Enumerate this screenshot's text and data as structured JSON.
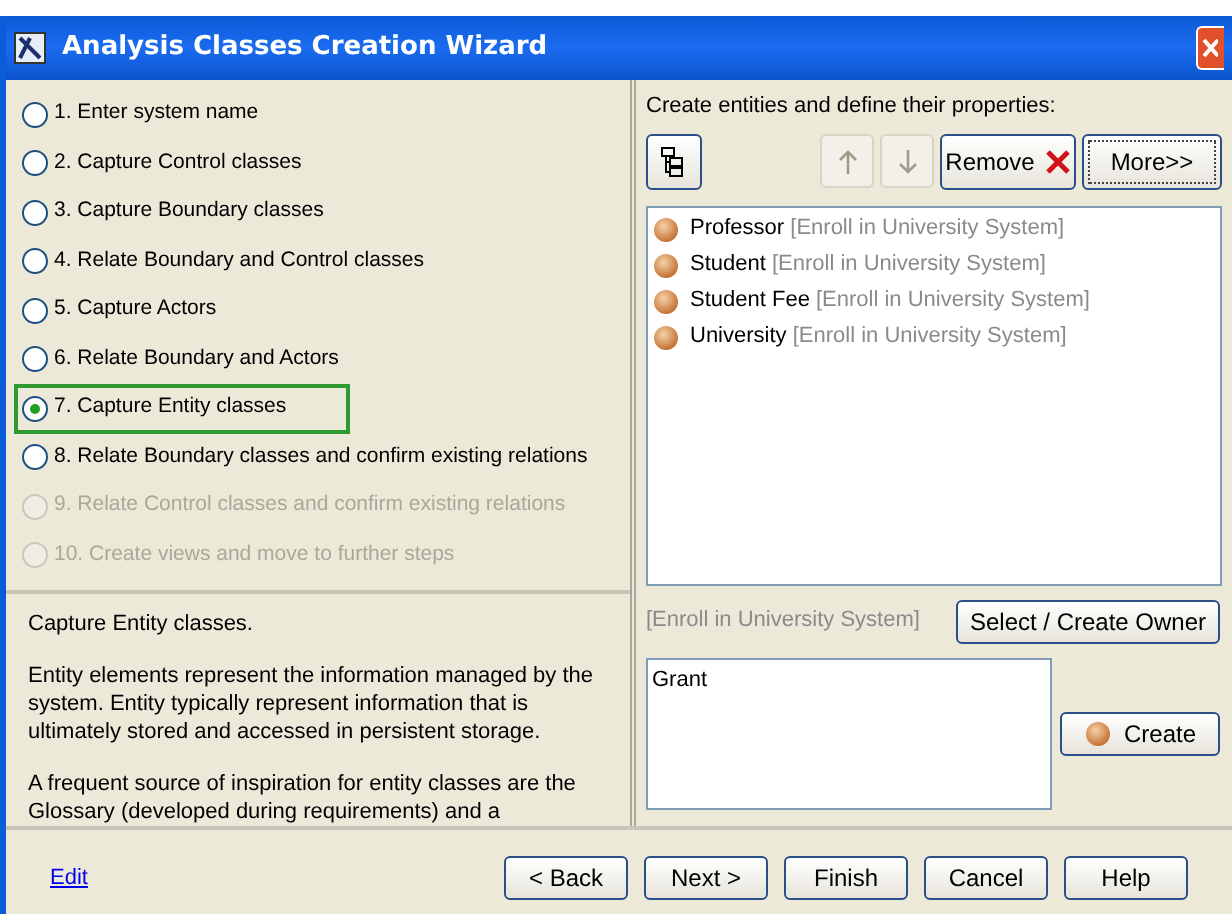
{
  "window": {
    "title": "Analysis Classes Creation Wizard"
  },
  "steps": [
    {
      "label": "1. Enter system name",
      "selected": false,
      "disabled": false
    },
    {
      "label": "2. Capture Control classes",
      "selected": false,
      "disabled": false
    },
    {
      "label": "3. Capture Boundary classes",
      "selected": false,
      "disabled": false
    },
    {
      "label": "4. Relate Boundary and Control classes",
      "selected": false,
      "disabled": false
    },
    {
      "label": "5. Capture Actors",
      "selected": false,
      "disabled": false
    },
    {
      "label": "6. Relate Boundary and Actors",
      "selected": false,
      "disabled": false
    },
    {
      "label": "7. Capture Entity classes",
      "selected": true,
      "disabled": false
    },
    {
      "label": "8. Relate Boundary classes and confirm existing relations",
      "selected": false,
      "disabled": false
    },
    {
      "label": "9. Relate Control classes and confirm existing relations",
      "selected": false,
      "disabled": true
    },
    {
      "label": "10. Create views and move to further steps",
      "selected": false,
      "disabled": true
    }
  ],
  "description": [
    "Capture Entity classes.",
    "Entity elements represent the information managed by the system. Entity typically represent information that is ultimately stored and accessed in persistent storage.",
    "A frequent source of inspiration for entity classes are the Glossary (developed during requirements) and a"
  ],
  "edit_link": "Edit",
  "right": {
    "instruction": "Create entities and define their properties:",
    "toolbar": {
      "remove": "Remove",
      "more": "More>>"
    },
    "entities": [
      {
        "name": "Professor",
        "owner": "[Enroll in University System]"
      },
      {
        "name": "Student",
        "owner": "[Enroll in University System]"
      },
      {
        "name": "Student Fee",
        "owner": "[Enroll in University System]"
      },
      {
        "name": "University",
        "owner": "[Enroll in University System]"
      }
    ],
    "owner_label": "[Enroll in University System]",
    "owner_button": "Select / Create Owner",
    "name_value": "Grant",
    "create_button": "Create"
  },
  "buttons": [
    "< Back",
    "Next >",
    "Finish",
    "Cancel",
    "Help"
  ]
}
